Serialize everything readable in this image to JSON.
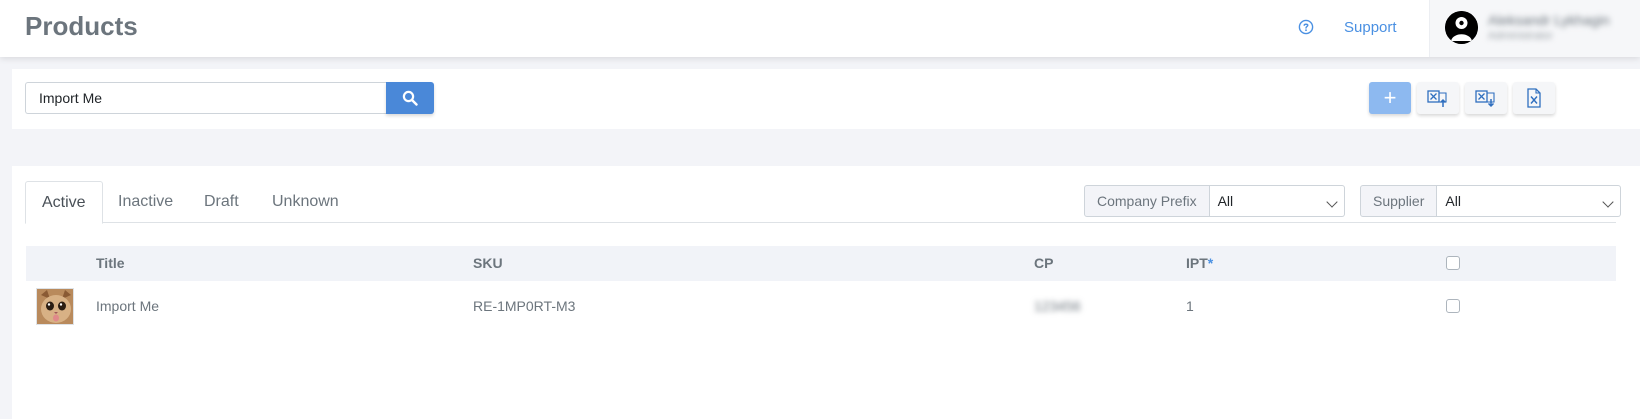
{
  "header": {
    "title": "Products",
    "help_icon": "question-circle-icon",
    "support_label": "Support",
    "user": {
      "name": "Aleksandr Lykhagin",
      "role": "Administrator"
    }
  },
  "search": {
    "value": "Import Me",
    "button_icon": "search-icon"
  },
  "toolbar": {
    "add_label": "+",
    "buttons": [
      {
        "icon": "add-icon"
      },
      {
        "icon": "excel-import-icon"
      },
      {
        "icon": "excel-export-icon"
      },
      {
        "icon": "excel-file-icon"
      }
    ],
    "accent_color": "#4a88d8"
  },
  "tabs": [
    {
      "label": "Active",
      "active": true
    },
    {
      "label": "Inactive",
      "active": false
    },
    {
      "label": "Draft",
      "active": false
    },
    {
      "label": "Unknown",
      "active": false
    }
  ],
  "filters": {
    "company_prefix": {
      "label": "Company Prefix",
      "value": "All"
    },
    "supplier": {
      "label": "Supplier",
      "value": "All"
    }
  },
  "table": {
    "columns": [
      "Title",
      "SKU",
      "CP",
      "IPT",
      "*"
    ],
    "rows": [
      {
        "image": "cat-photo",
        "title": "Import Me",
        "sku": "RE-1MP0RT-M3",
        "cp": "123456",
        "ipt": "1"
      }
    ]
  }
}
